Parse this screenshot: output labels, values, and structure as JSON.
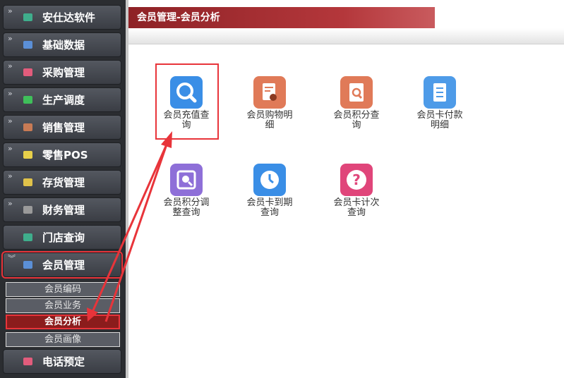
{
  "sidebar": {
    "items": [
      {
        "label": "安仕达软件",
        "icon": "app-logo-icon",
        "color": "#3fae8c"
      },
      {
        "label": "基础数据",
        "icon": "database-icon",
        "color": "#5b8fd6"
      },
      {
        "label": "采购管理",
        "icon": "purchase-icon",
        "color": "#e25c7c"
      },
      {
        "label": "生产调度",
        "icon": "production-icon",
        "color": "#3fbf5a"
      },
      {
        "label": "销售管理",
        "icon": "sales-icon",
        "color": "#c87b55"
      },
      {
        "label": "零售POS",
        "icon": "pos-icon",
        "color": "#e8d04a"
      },
      {
        "label": "存货管理",
        "icon": "inventory-icon",
        "color": "#e0c24a"
      },
      {
        "label": "财务管理",
        "icon": "finance-icon",
        "color": "#9a9a9a"
      },
      {
        "label": "门店查询",
        "icon": "store-icon",
        "color": "#3fae8c"
      },
      {
        "label": "会员管理",
        "icon": "member-icon",
        "color": "#5b8fd6"
      },
      {
        "label": "电话预定",
        "icon": "phone-icon",
        "color": "#e25c7c"
      }
    ],
    "member_sub": [
      "会员编码",
      "会员业务",
      "会员分析",
      "会员画像"
    ]
  },
  "header": {
    "title": "会员管理-会员分析"
  },
  "tiles": [
    {
      "label": "会员充值查询",
      "icon": "magnifier-icon",
      "color": "#3a8ee6"
    },
    {
      "label": "会员购物明细",
      "icon": "shopping-detail-icon",
      "color": "#e07a58"
    },
    {
      "label": "会员积分查询",
      "icon": "points-search-icon",
      "color": "#e07a58"
    },
    {
      "label": "会员卡付款明细",
      "icon": "document-list-icon",
      "color": "#4e9be8"
    },
    {
      "label": "会员积分调整查询",
      "icon": "adjust-search-icon",
      "color": "#8e6fd8"
    },
    {
      "label": "会员卡到期查询",
      "icon": "clock-icon",
      "color": "#3a8ee6"
    },
    {
      "label": "会员卡计次查询",
      "icon": "question-icon",
      "color": "#e0457a"
    }
  ],
  "theme": {
    "accent": "#e8343a",
    "header": "#a52b30"
  }
}
